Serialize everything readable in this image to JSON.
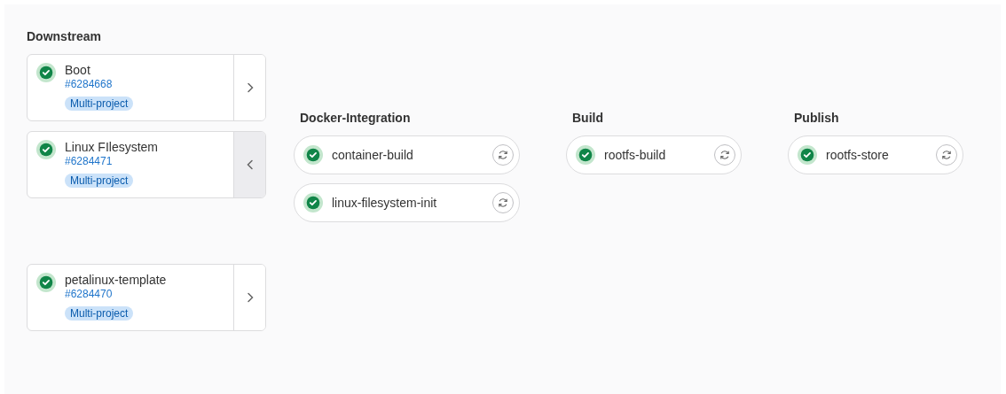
{
  "downstream": {
    "title": "Downstream",
    "pipelines": [
      {
        "name": "Boot",
        "id": "#6284668",
        "badge": "Multi-project",
        "passed": true,
        "expanded": false
      },
      {
        "name": "Linux FIlesystem",
        "id": "#6284471",
        "badge": "Multi-project",
        "passed": true,
        "expanded": true
      },
      {
        "name": "petalinux-template",
        "id": "#6284470",
        "badge": "Multi-project",
        "passed": true,
        "expanded": false
      }
    ]
  },
  "stages": [
    {
      "title": "Docker-Integration",
      "jobs": [
        {
          "name": "container-build",
          "passed": true
        },
        {
          "name": "linux-filesystem-init",
          "passed": true
        }
      ]
    },
    {
      "title": "Build",
      "jobs": [
        {
          "name": "rootfs-build",
          "passed": true
        }
      ]
    },
    {
      "title": "Publish",
      "jobs": [
        {
          "name": "rootfs-store",
          "passed": true
        }
      ]
    }
  ]
}
